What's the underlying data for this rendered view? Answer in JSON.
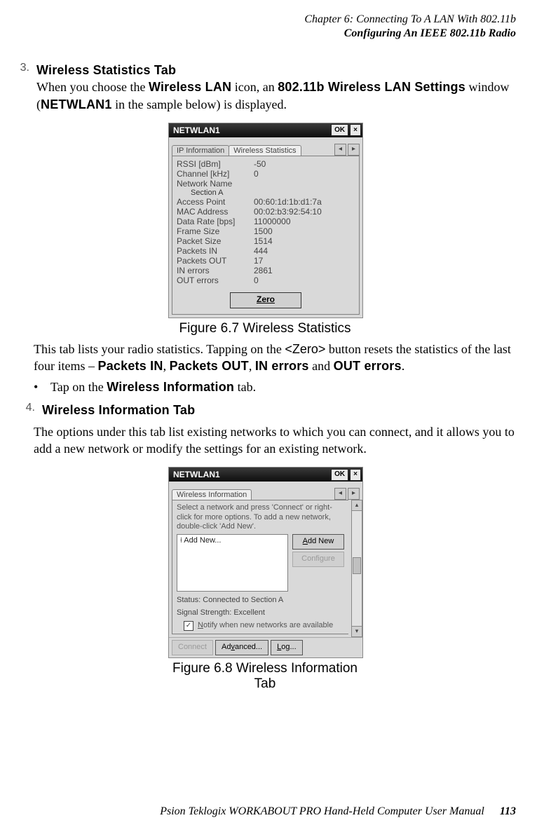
{
  "header": {
    "chapter": "Chapter 6: Connecting To A LAN With 802.11b",
    "section": "Configuring An IEEE 802.11b Radio"
  },
  "step3": {
    "num": "3.",
    "title": "Wireless Statistics Tab",
    "intro_a": "When you choose the ",
    "intro_b": "Wireless LAN",
    "intro_c": " icon, an ",
    "intro_d": "802.11b Wireless LAN Settings",
    "intro_e": " window (",
    "intro_f": "NETWLAN1",
    "intro_g": " in the sample below) is displayed."
  },
  "win1": {
    "title": "NETWLAN1",
    "ok": "OK",
    "tabs": {
      "ip": "IP Information",
      "ws": "Wireless Statistics"
    },
    "rows": [
      {
        "label": "RSSI [dBm]",
        "value": "-50"
      },
      {
        "label": "Channel [kHz]",
        "value": "0"
      },
      {
        "label": "Network Name",
        "value": ""
      }
    ],
    "net_sub": "Section A",
    "rows2": [
      {
        "label": "Access Point",
        "value": "00:60:1d:1b:d1:7a"
      },
      {
        "label": "MAC Address",
        "value": "00:02:b3:92:54:10"
      },
      {
        "label": "Data Rate [bps]",
        "value": "11000000"
      },
      {
        "label": "Frame Size",
        "value": "1500"
      },
      {
        "label": "Packet Size",
        "value": "1514"
      },
      {
        "label": "Packets IN",
        "value": "444"
      },
      {
        "label": "Packets OUT",
        "value": "17"
      },
      {
        "label": "IN errors",
        "value": "2861"
      },
      {
        "label": "OUT errors",
        "value": "0"
      }
    ],
    "zero": "Zero"
  },
  "fig1": "Figure 6.7 Wireless Statistics",
  "para1": {
    "a": "This tab lists your radio statistics. Tapping on the ",
    "b": "<Zero>",
    "c": " button resets the statistics of the last four items – ",
    "d": "Packets IN",
    "e": ", ",
    "f": "Packets OUT",
    "g": ", ",
    "h": "IN errors",
    "i": " and ",
    "j": "OUT errors",
    "k": "."
  },
  "bullet1": {
    "a": "Tap on the ",
    "b": "Wireless Information",
    "c": " tab."
  },
  "step4": {
    "num": "4.",
    "title": "Wireless Information Tab"
  },
  "para2": "The options under this tab list existing networks to which you can connect, and it allows you to add a new network or modify the settings for an existing network.",
  "win2": {
    "title": "NETWLAN1",
    "ok": "OK",
    "tab": "Wireless Information",
    "hint": "Select a network and press 'Connect' or right-click for more options.  To add a new network, double-click 'Add New'.",
    "list_item": "Add New...",
    "btn_add": "Add New",
    "btn_cfg": "Configure",
    "status": "Status:  Connected to Section A",
    "signal": "Signal Strength:  Excellent",
    "notify": "Notify when new networks are available",
    "connect": "Connect",
    "advanced": "Advanced...",
    "log": "Log..."
  },
  "fig2": "Figure 6.8 Wireless Information Tab",
  "footer": {
    "text": "Psion Teklogix WORKABOUT PRO Hand-Held Computer User Manual",
    "page": "113"
  }
}
